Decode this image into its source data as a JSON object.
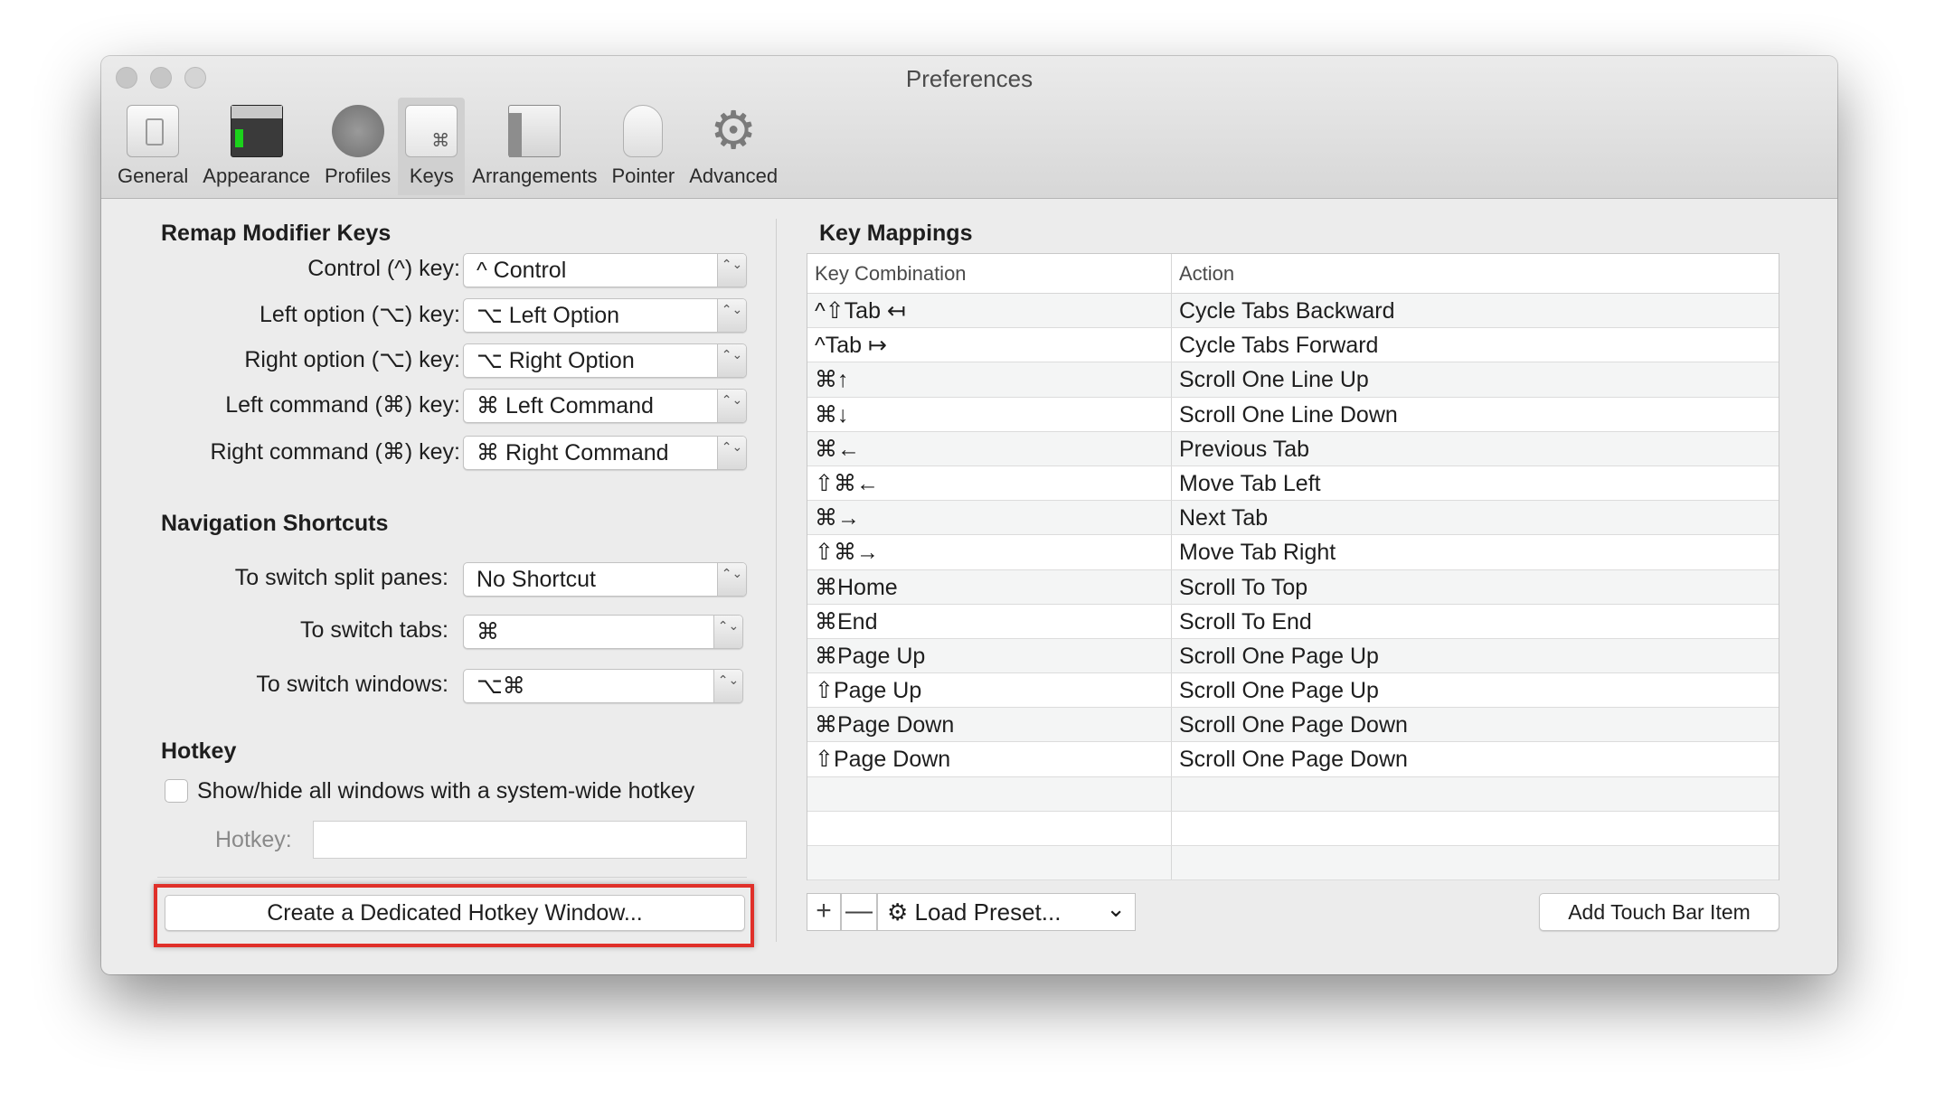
{
  "window": {
    "title": "Preferences"
  },
  "toolbar": {
    "tabs": [
      {
        "label": "General"
      },
      {
        "label": "Appearance"
      },
      {
        "label": "Profiles"
      },
      {
        "label": "Keys",
        "key_glyph": "⌘"
      },
      {
        "label": "Arrangements"
      },
      {
        "label": "Pointer"
      },
      {
        "label": "Advanced",
        "glyph": "⚙"
      }
    ]
  },
  "remap": {
    "title": "Remap Modifier Keys",
    "rows": [
      {
        "label": "Control (^) key:",
        "value": "^ Control"
      },
      {
        "label": "Left option (⌥) key:",
        "value": "⌥ Left Option"
      },
      {
        "label": "Right option (⌥) key:",
        "value": "⌥ Right Option"
      },
      {
        "label": "Left command (⌘) key:",
        "value": "⌘ Left Command"
      },
      {
        "label": "Right command (⌘) key:",
        "value": "⌘ Right Command"
      }
    ]
  },
  "navigation": {
    "title": "Navigation Shortcuts",
    "rows": [
      {
        "label": "To switch split panes:",
        "value": "No Shortcut"
      },
      {
        "label": "To switch tabs:",
        "value": "⌘"
      },
      {
        "label": "To switch windows:",
        "value": "⌥⌘"
      }
    ]
  },
  "hotkey": {
    "title": "Hotkey",
    "checkbox_label": "Show/hide all windows with a system-wide hotkey",
    "field_label": "Hotkey:",
    "field_value": "",
    "create_button": "Create a Dedicated Hotkey Window..."
  },
  "key_mappings": {
    "title": "Key Mappings",
    "columns": [
      "Key Combination",
      "Action"
    ],
    "rows": [
      {
        "key": "^⇧Tab ↤",
        "action": "Cycle Tabs Backward"
      },
      {
        "key": "^Tab ↦",
        "action": "Cycle Tabs Forward"
      },
      {
        "key": "⌘↑",
        "action": "Scroll One Line Up"
      },
      {
        "key": "⌘↓",
        "action": "Scroll One Line Down"
      },
      {
        "key": "⌘←",
        "action": "Previous Tab"
      },
      {
        "key": "⇧⌘←",
        "action": "Move Tab Left"
      },
      {
        "key": "⌘→",
        "action": "Next Tab"
      },
      {
        "key": "⇧⌘→",
        "action": "Move Tab Right"
      },
      {
        "key": "⌘Home",
        "action": "Scroll To Top"
      },
      {
        "key": "⌘End",
        "action": "Scroll To End"
      },
      {
        "key": "⌘Page Up",
        "action": "Scroll One Page Up"
      },
      {
        "key": "⇧Page Up",
        "action": "Scroll One Page Up"
      },
      {
        "key": "⌘Page Down",
        "action": "Scroll One Page Down"
      },
      {
        "key": "⇧Page Down",
        "action": "Scroll One Page Down"
      },
      {
        "key": "",
        "action": ""
      },
      {
        "key": "",
        "action": ""
      },
      {
        "key": "",
        "action": ""
      }
    ],
    "add_glyph": "+",
    "remove_glyph": "—",
    "preset_gear": "⚙",
    "preset_label": "Load Preset...",
    "preset_chevron": "⌄",
    "touchbar_button": "Add Touch Bar Item"
  },
  "stepper_glyph": "⌃⌄",
  "colors": {
    "highlight": "#e0302a",
    "window_bg": "#ececec",
    "toolbar_bg": "#d7d7d7"
  }
}
